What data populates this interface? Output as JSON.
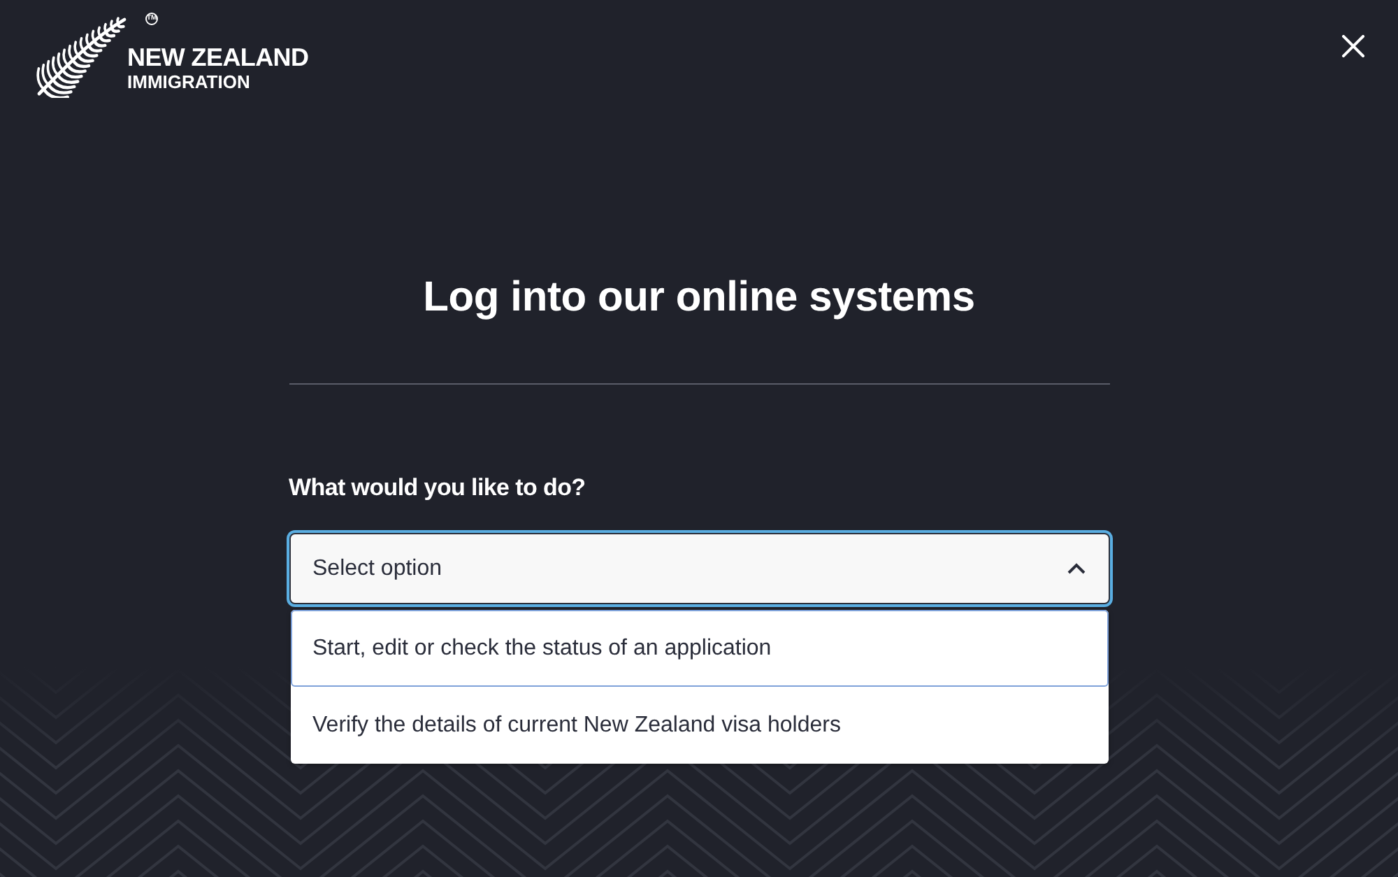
{
  "header": {
    "logo": {
      "mark": "TM",
      "line_1": "NEW ZEALAND",
      "line_2": "IMMIGRATION"
    }
  },
  "main": {
    "title": "Log into our online systems",
    "question": "What would you like to do?",
    "select": {
      "placeholder": "Select option",
      "expanded": true,
      "focused": true,
      "options": [
        {
          "label": "Start, edit or check the status of an application",
          "selected": true
        },
        {
          "label": "Verify the details of current New Zealand visa holders",
          "selected": false
        }
      ]
    }
  }
}
